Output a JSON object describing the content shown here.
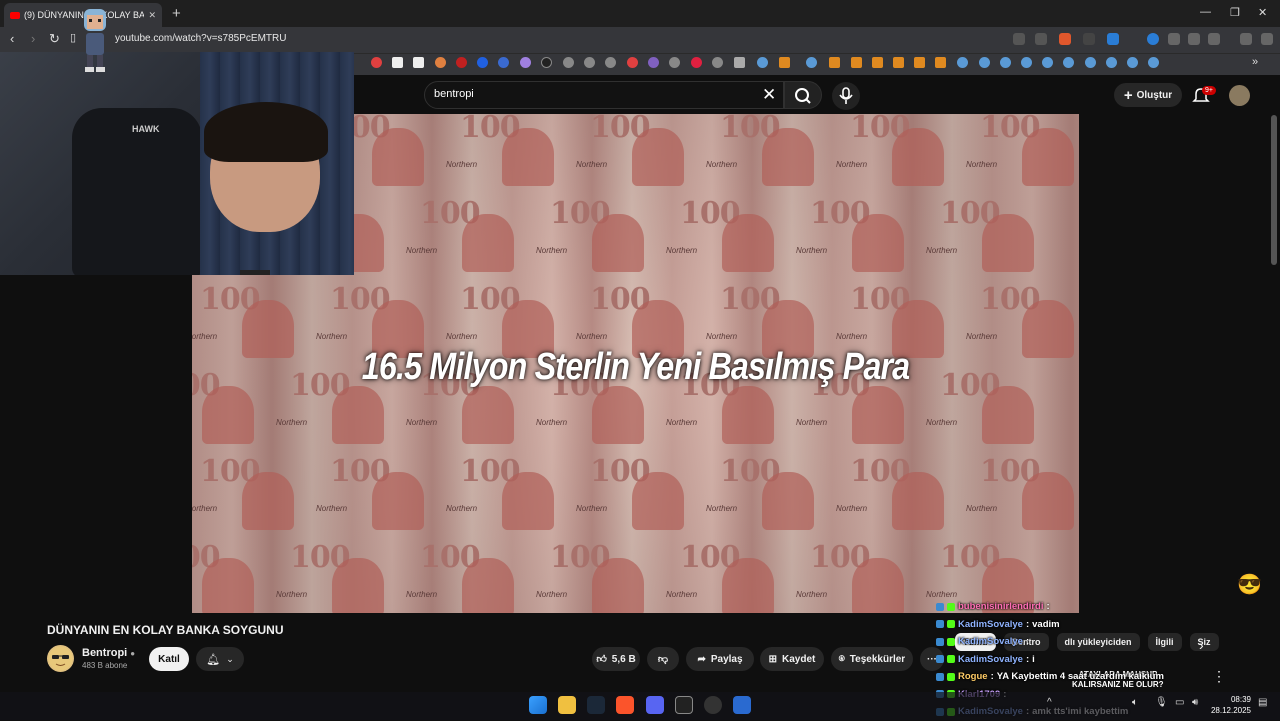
{
  "browser": {
    "tab_title": "(9) DÜNYANIN EN KOLAY BA",
    "url": "youtube.com/watch?v=s785PcEMTRU",
    "new_tab": "+",
    "tab_close": "✕"
  },
  "youtube": {
    "search_value": "bentropi",
    "create_label": "Oluştur",
    "notif_count": "9+"
  },
  "video": {
    "overlay_title": "16.5 Milyon Sterlin Yeni Basılmış Para",
    "note_value": "100",
    "note_brand": "Northern",
    "title": "DÜNYANIN EN KOLAY BANKA SOYGUNU"
  },
  "channel": {
    "name": "Bentropi",
    "subscribers": "483 B abone",
    "join_label": "Katıl"
  },
  "actions": {
    "likes": "5,6 B",
    "share": "Paylaş",
    "save": "Kaydet",
    "thanks": "Teşekkürler",
    "more": "···"
  },
  "webcam": {
    "chair_brand": "HAWK"
  },
  "chips": [
    "Tümü",
    "Bentro",
    "dlı yükleyiciden",
    "İlgili",
    "Siz"
  ],
  "overlay_sub": "...ATAYLARA MAHSUP KALIRSANIZ NE OLUR?",
  "chat": [
    {
      "user": "bubenisinirlendirdi",
      "msg": "",
      "color": "#ff6eb4"
    },
    {
      "user": "KadimSovalye",
      "msg": "vadim",
      "color": "#8fb3ff"
    },
    {
      "user": "KadimSovalye",
      "msg": "",
      "color": "#8fb3ff"
    },
    {
      "user": "KadimSovalye",
      "msg": "i",
      "color": "#8fb3ff"
    },
    {
      "user": "Rogue",
      "msg": "YA Kaybettim 4 saat uzardım kaikium",
      "color": "#ffcc66"
    },
    {
      "user": "Kiari1709",
      "msg": "",
      "color": "#c9a0ff"
    },
    {
      "user": "KadimSovalye",
      "msg": "amk tts'imi kaybettim",
      "color": "#8fb3ff"
    }
  ],
  "taskbar": {
    "time": "08:39",
    "date": "28.12.2025"
  },
  "colors": {
    "yt_red": "#ff0000",
    "bg": "#0f0f0f",
    "chip_bg": "#272727"
  }
}
